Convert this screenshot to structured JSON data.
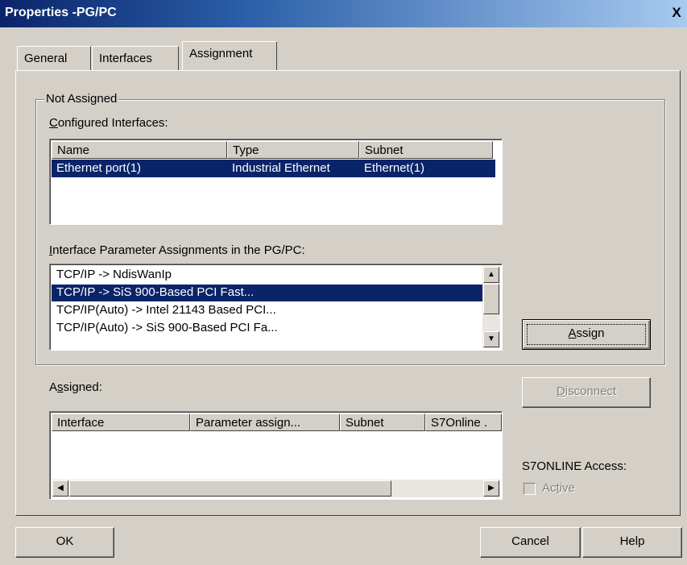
{
  "window": {
    "title": "Properties -PG/PC",
    "close_glyph": "X"
  },
  "tabs": [
    {
      "label": "General"
    },
    {
      "label": "Interfaces"
    },
    {
      "label": "Assignment"
    }
  ],
  "not_assigned": {
    "group_label": "Not Assigned",
    "configured_label_u": "C",
    "configured_label_rest": "onfigured Interfaces:",
    "configured_columns": [
      "Name",
      "Type",
      "Subnet"
    ],
    "configured_rows": [
      {
        "name": "Ethernet port(1)",
        "type": "Industrial Ethernet",
        "subnet": "Ethernet(1)",
        "selected": true
      }
    ],
    "param_label_u": "I",
    "param_label_rest": "nterface Parameter Assignments in the PG/PC:",
    "param_items": [
      {
        "text": "TCP/IP -> NdisWanIp",
        "selected": false
      },
      {
        "text": "TCP/IP -> SiS 900-Based PCI Fast...",
        "selected": true
      },
      {
        "text": "TCP/IP(Auto) -> Intel 21143 Based PCI...",
        "selected": false
      },
      {
        "text": "TCP/IP(Auto) -> SiS 900-Based PCI Fa...",
        "selected": false
      }
    ],
    "assign_button_u": "A",
    "assign_button_rest": "ssign"
  },
  "assigned": {
    "label_pre": "A",
    "label_u": "s",
    "label_rest": "signed:",
    "columns": [
      "Interface",
      "Parameter assign...",
      "Subnet",
      "S7Online ."
    ],
    "disconnect_button_u": "D",
    "disconnect_button_rest": "isconnect",
    "s7online_label": "S7ONLINE Access:",
    "active_label_pre": "Ac",
    "active_label_u": "t",
    "active_label_rest": "ive",
    "active_checked": false
  },
  "footer": {
    "ok_label": "OK",
    "cancel_label": "Cancel",
    "help_label": "Help"
  },
  "colors": {
    "selection": "#0a246a",
    "face": "#d4d0c8"
  }
}
